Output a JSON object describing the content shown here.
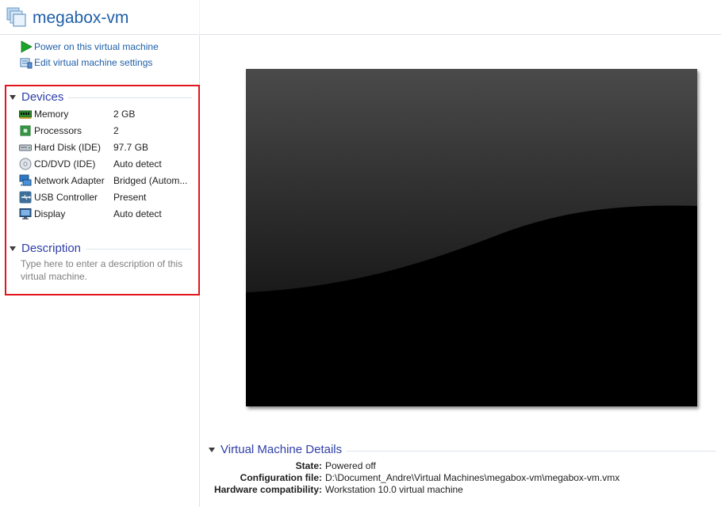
{
  "window": {
    "title": "megabox-vm"
  },
  "actions": [
    {
      "label": "Power on this virtual machine",
      "icon": "play-icon"
    },
    {
      "label": "Edit virtual machine settings",
      "icon": "settings-icon"
    }
  ],
  "devices": {
    "header": "Devices",
    "items": [
      {
        "name": "Memory",
        "value": "2 GB",
        "icon": "memory-icon"
      },
      {
        "name": "Processors",
        "value": "2",
        "icon": "processor-icon"
      },
      {
        "name": "Hard Disk (IDE)",
        "value": "97.7 GB",
        "icon": "hard-disk-icon"
      },
      {
        "name": "CD/DVD (IDE)",
        "value": "Auto detect",
        "icon": "cd-dvd-icon"
      },
      {
        "name": "Network Adapter",
        "value": "Bridged (Autom...",
        "icon": "network-adapter-icon"
      },
      {
        "name": "USB Controller",
        "value": "Present",
        "icon": "usb-icon"
      },
      {
        "name": "Display",
        "value": "Auto detect",
        "icon": "display-icon"
      }
    ]
  },
  "description": {
    "header": "Description",
    "placeholder": "Type here to enter a description of this virtual machine."
  },
  "details": {
    "header": "Virtual Machine Details",
    "rows": [
      {
        "key": "State:",
        "value": "Powered off"
      },
      {
        "key": "Configuration file:",
        "value": "D:\\Document_Andre\\Virtual Machines\\megabox-vm\\megabox-vm.vmx"
      },
      {
        "key": "Hardware compatibility:",
        "value": "Workstation 10.0 virtual machine"
      }
    ]
  },
  "colors": {
    "link": "#1f5fa8",
    "section_header": "#2f3fa8",
    "highlight_box": "#e3141c",
    "screen_bg": "#000000"
  }
}
